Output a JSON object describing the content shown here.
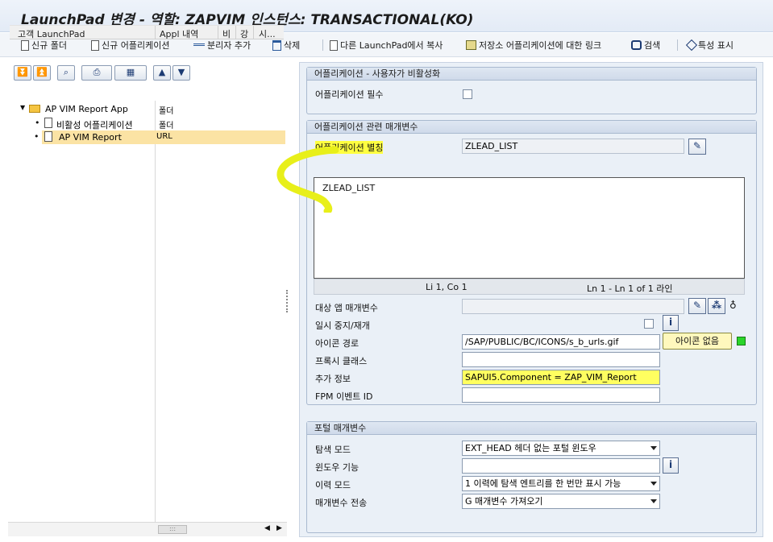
{
  "window": {
    "title": "LaunchPad 변경 - 역할: ZAPVIM 인스턴스: TRANSACTIONAL(KO)"
  },
  "toolbar": {
    "new_folder": "신규 폴더",
    "new_app": "신규 어플리케이션",
    "add_separator": "분리자 추가",
    "delete": "삭제",
    "copy_from_launchpad": "다른 LaunchPad에서 복사",
    "repo_link": "저장소 어플리케이션에 대한 링크",
    "search": "검색",
    "show_props": "특성 표시"
  },
  "tree": {
    "columns": [
      "고객 LaunchPad",
      "Appl 내역",
      "비",
      "강",
      "시..."
    ],
    "rows": [
      {
        "label": "AP VIM Report App",
        "type": "폴더",
        "level": 0,
        "icon": "folder-icon",
        "expanded": true
      },
      {
        "label": "비활성 어플리케이션",
        "type": "폴더",
        "level": 1,
        "icon": "page-icon"
      },
      {
        "label": "AP VIM Report",
        "type": "URL",
        "level": 1,
        "icon": "page-icon",
        "selected": true
      }
    ]
  },
  "section_deactivation": {
    "title": "어플리케이션 - 사용자가 비활성화",
    "required_label": "어플리케이션 필수",
    "required_checked": false
  },
  "section_params": {
    "title": "어플리케이션 관련 매개변수",
    "alias_label": "어플리케이션 별칭",
    "alias_value": "ZLEAD_LIST",
    "editor_text": "ZLEAD_LIST",
    "editor_pos": "Li 1, Co 1",
    "editor_lines": "Ln 1 - Ln 1 of 1 라인",
    "target_params_label": "대상 앱 매개변수",
    "target_params_value": "",
    "pause_label": "일시 중지/재개",
    "pause_checked": false,
    "icon_path_label": "아이콘 경로",
    "icon_path_value": "/SAP/PUBLIC/BC/ICONS/s_b_urls.gif",
    "no_icon_button": "아이콘 없음",
    "proxy_class_label": "프록시 클래스",
    "proxy_class_value": "",
    "extra_info_label": "추가 정보",
    "extra_info_value": "SAPUI5.Component = ZAP_VIM_Report",
    "fpm_event_label": "FPM 이벤트 ID",
    "fpm_event_value": ""
  },
  "section_portal": {
    "title": "포털 매개변수",
    "nav_mode_label": "탐색 모드",
    "nav_mode_value": "EXT_HEAD 헤더 없는 포털 윈도우",
    "window_func_label": "윈도우 기능",
    "window_func_value": "",
    "history_mode_label": "이력 모드",
    "history_mode_value": "1 이력에 탐색 엔트리를 한 번만 표시 가능",
    "param_transfer_label": "매개변수 전송",
    "param_transfer_value": "G 매개변수 가져오기"
  },
  "colors": {
    "highlight": "#ffff40",
    "selection": "#fbe3a4",
    "group_bg": "#eaf0f7"
  }
}
